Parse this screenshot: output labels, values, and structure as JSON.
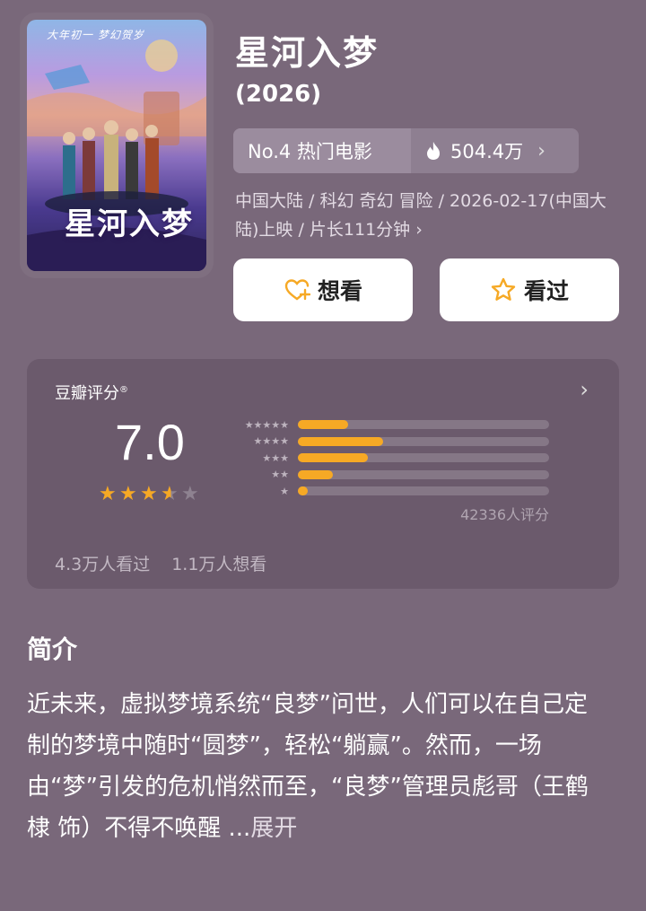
{
  "movie": {
    "title": "星河入梦",
    "year": "(2026)",
    "poster": {
      "tagline": "大年初一 梦幻贺岁",
      "logo_text": "星河入梦"
    },
    "rank": {
      "label": "No.4 热门电影",
      "heat_value": "504.4万",
      "chevron": "›"
    },
    "meta_text": "中国大陆 / 科幻 奇幻 冒险 / 2026-02-17(中国大陆)上映 / 片长111分钟 ›"
  },
  "actions": {
    "want_label": "想看",
    "seen_label": "看过"
  },
  "rating": {
    "label": "豆瓣评分",
    "mark": "®",
    "chevron": "›",
    "score": "7.0",
    "stars_value": 3.5,
    "distribution": [
      {
        "stars": "★★★★★",
        "percent": 20
      },
      {
        "stars": "★★★★",
        "percent": 34
      },
      {
        "stars": "★★★",
        "percent": 28
      },
      {
        "stars": "★★",
        "percent": 14
      },
      {
        "stars": "★",
        "percent": 4
      }
    ],
    "count_text": "42336人评分",
    "seen_text": "4.3万人看过",
    "want_text": "1.1万人想看"
  },
  "intro": {
    "heading": "简介",
    "text": "近未来，虚拟梦境系统“良梦”问世，人们可以在自己定制的梦境中随时“圆梦”，轻松“躺赢”。然而，一场由“梦”引发的危机悄然而至，“良梦”管理员彪哥（王鹤棣 饰）不得不唤醒 ...",
    "expand_label": "展开"
  },
  "colors": {
    "background": "#79687a",
    "card": "#6b5a6c",
    "star": "#f6a925",
    "star_empty": "#8e8290"
  }
}
